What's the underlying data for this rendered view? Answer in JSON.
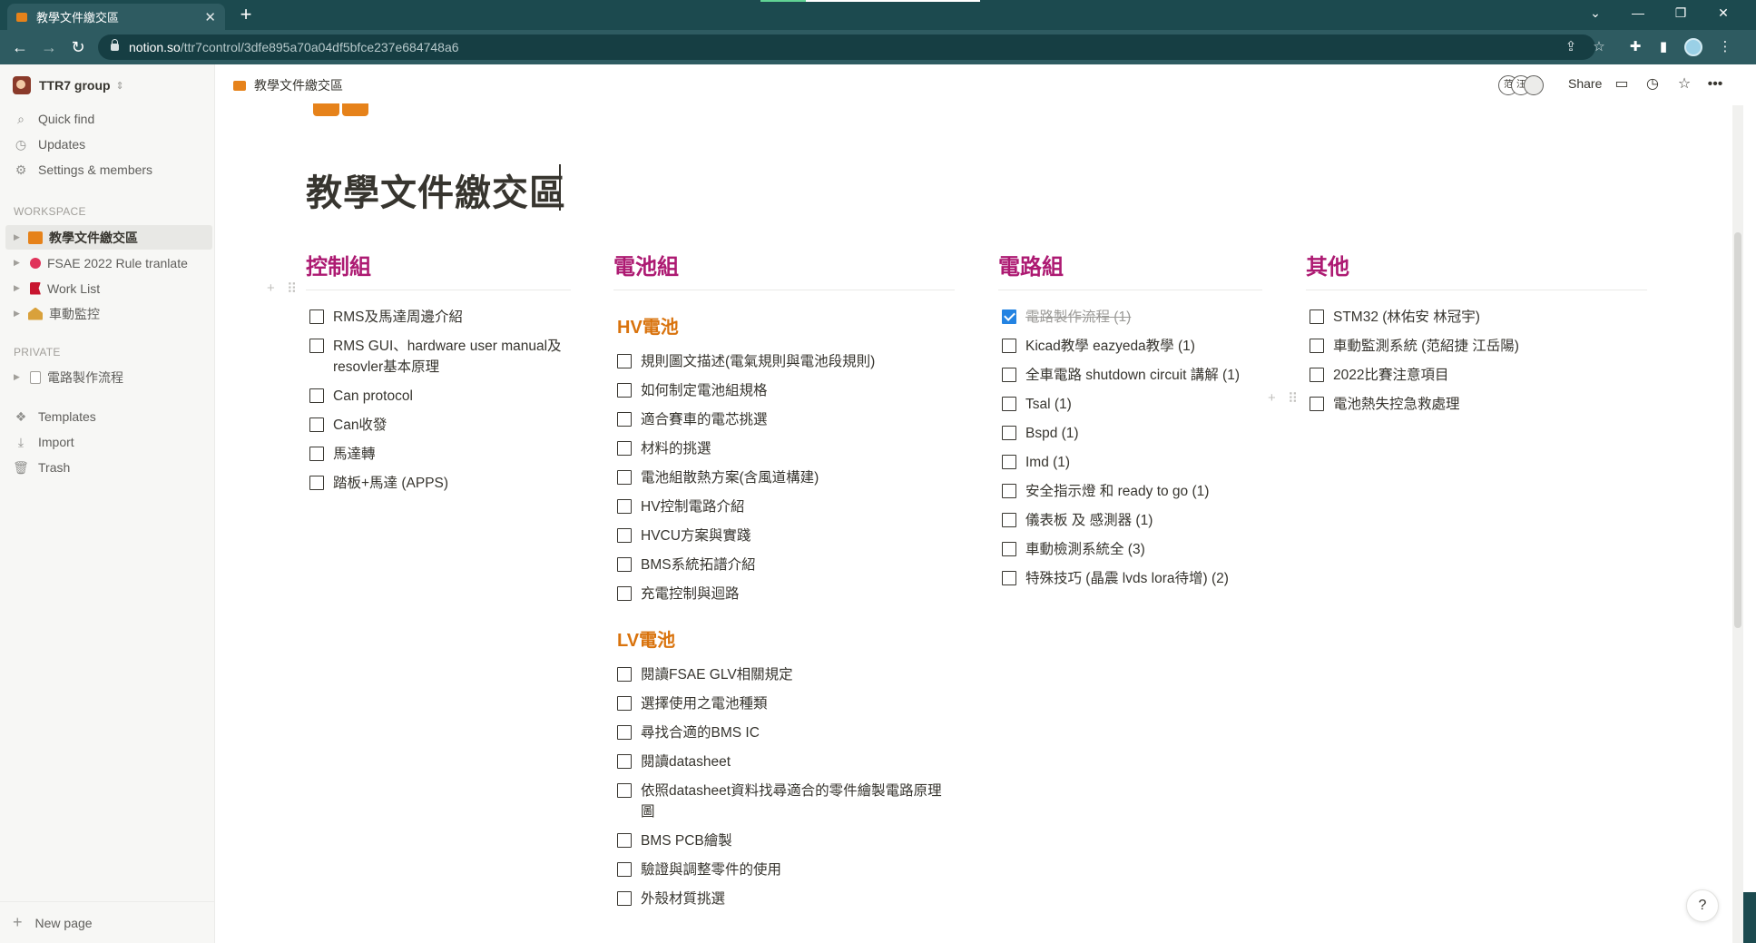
{
  "browser": {
    "tab_title": "教學文件繳交區",
    "tab_close": "✕",
    "new_tab": "+",
    "url_host": "notion.so",
    "url_path": "/ttr7control/3dfe895a70a04df5bfce237e684748a6"
  },
  "sidebar": {
    "workspace_name": "TTR7 group",
    "quick_find": "Quick find",
    "updates": "Updates",
    "settings": "Settings & members",
    "workspace_heading": "WORKSPACE",
    "workspace_pages": [
      {
        "label": "教學文件繳交區",
        "icon": "book-icon"
      },
      {
        "label": "FSAE 2022 Rule tranlate",
        "icon": "blossom-icon"
      },
      {
        "label": "Work List",
        "icon": "flag-icon"
      },
      {
        "label": "車動監控",
        "icon": "house-icon"
      }
    ],
    "private_heading": "PRIVATE",
    "private_pages": [
      {
        "label": "電路製作流程",
        "icon": "page-icon"
      }
    ],
    "templates": "Templates",
    "import": "Import",
    "trash": "Trash",
    "new_page": "New page"
  },
  "topbar": {
    "breadcrumb": "教學文件繳交區",
    "share": "Share",
    "avatar_1": "范",
    "avatar_2": "汪"
  },
  "page": {
    "title": "教學文件繳交區",
    "columns": [
      {
        "heading": "控制組",
        "items": [
          "RMS及馬達周邊介紹",
          "RMS GUI、hardware user manual及resovler基本原理",
          "Can protocol",
          "Can收發",
          "馬達轉",
          " 踏板+馬達 (APPS)"
        ]
      },
      {
        "heading": "電池組",
        "hv_heading": "HV電池",
        "hv_items": [
          "規則圖文描述(電氣規則與電池段規則)",
          "如何制定電池組規格",
          "適合賽車的電芯挑選",
          "材料的挑選",
          "電池組散熱方案(含風道構建)",
          "HV控制電路介紹",
          "HVCU方案與實踐",
          "BMS系統拓譜介紹",
          "充電控制與迴路"
        ],
        "lv_heading": "LV電池",
        "lv_items": [
          "閱讀FSAE GLV相關規定",
          "選擇使用之電池種類",
          "尋找合適的BMS IC",
          "閱讀datasheet",
          "依照datasheet資料找尋適合的零件繪製電路原理圖",
          "BMS PCB繪製",
          "驗證與調整零件的使用",
          "外殼材質挑選"
        ]
      },
      {
        "heading": "電路組",
        "done_item": "電路製作流程 (1)",
        "items": [
          " Kicad教學 eazyeda教學 (1)",
          "全車電路 shutdown circuit 講解 (1)",
          "Tsal (1)",
          "Bspd (1)",
          "Imd (1)",
          "安全指示燈 和 ready to go (1)",
          "儀表板 及 感測器 (1)",
          "車動檢測系統全 (3)",
          "特殊技巧 (晶震 lvds lora待增) (2)"
        ]
      },
      {
        "heading": "其他",
        "items": [
          "STM32 (林佑安 林冠宇)",
          "車動監測系統 (范紹捷 江岳陽)",
          "2022比賽注意項目",
          "電池熱失控急救處理"
        ]
      }
    ]
  },
  "help": "?",
  "colors": {
    "heading": "#ad1a72",
    "subheading": "#d9730d",
    "checked": "#2383e2",
    "chrome": "#1c4a4f"
  }
}
